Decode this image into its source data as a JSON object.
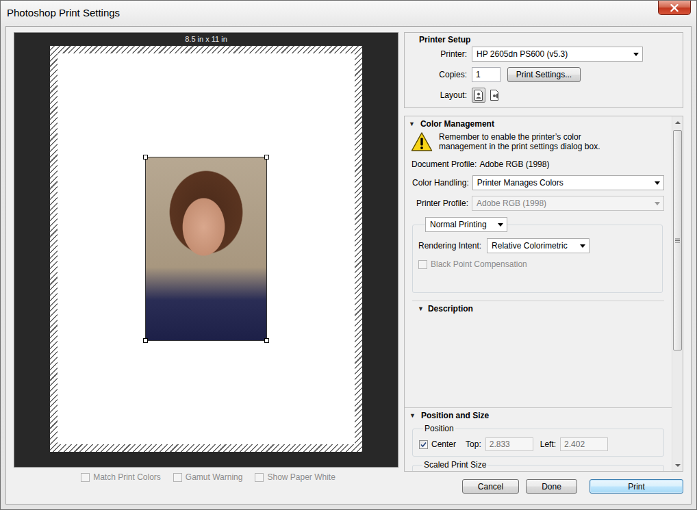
{
  "window": {
    "title": "Photoshop Print Settings"
  },
  "preview": {
    "paper_size": "8.5 in x 11 in"
  },
  "preview_options": [
    {
      "label": "Match Print Colors",
      "checked": false,
      "disabled": true
    },
    {
      "label": "Gamut Warning",
      "checked": false,
      "disabled": true
    },
    {
      "label": "Show Paper White",
      "checked": false,
      "disabled": true
    }
  ],
  "printer_setup": {
    "title": "Printer Setup",
    "printer": {
      "label": "Printer:",
      "value": "HP 2605dn PS600 (v5.3)"
    },
    "copies": {
      "label": "Copies:",
      "value": "1"
    },
    "print_settings_button": "Print Settings...",
    "layout": {
      "label": "Layout:",
      "options": [
        {
          "kind": "portrait",
          "selected": true
        },
        {
          "kind": "landscape",
          "selected": false
        }
      ]
    }
  },
  "settings_panel": {
    "scrollbar": {
      "level": 0.67
    },
    "color_management": {
      "toggle": "▼",
      "title": "Color Management",
      "expanded": true,
      "warning": "Remember to enable the printer’s color management in the print settings dialog box.",
      "document_profile": {
        "label": "Document Profile:",
        "value": "Adobe RGB (1998)"
      },
      "color_handling": {
        "label": "Color Handling:",
        "value": "Printer Manages Colors",
        "disabled": false
      },
      "printer_profile": {
        "label": "Printer Profile:",
        "value": "Adobe RGB (1998)",
        "disabled": true
      },
      "print_mode": {
        "value": "Normal Printing",
        "disabled": false
      },
      "rendering_intent": {
        "label": "Rendering Intent:",
        "value": "Relative Colorimetric",
        "disabled": false
      },
      "black_point_compensation": {
        "label": "Black Point Compensation",
        "checked": false,
        "disabled": true
      }
    },
    "description": {
      "toggle": "▼",
      "title": "Description",
      "expanded": true
    },
    "position_and_size": {
      "toggle": "▼",
      "title": "Position and Size",
      "expanded": true,
      "position": {
        "title": "Position",
        "center": {
          "label": "Center",
          "checked": true,
          "disabled": false
        },
        "top": {
          "label": "Top:",
          "value": "2.833",
          "disabled": true
        },
        "left": {
          "label": "Left:",
          "value": "2.402",
          "disabled": true
        }
      },
      "scaled_print_size": {
        "title": "Scaled Print Size"
      }
    }
  },
  "buttons": [
    {
      "label": "Cancel",
      "default": false
    },
    {
      "label": "Done",
      "default": false
    },
    {
      "label": "Print",
      "default": true
    }
  ]
}
